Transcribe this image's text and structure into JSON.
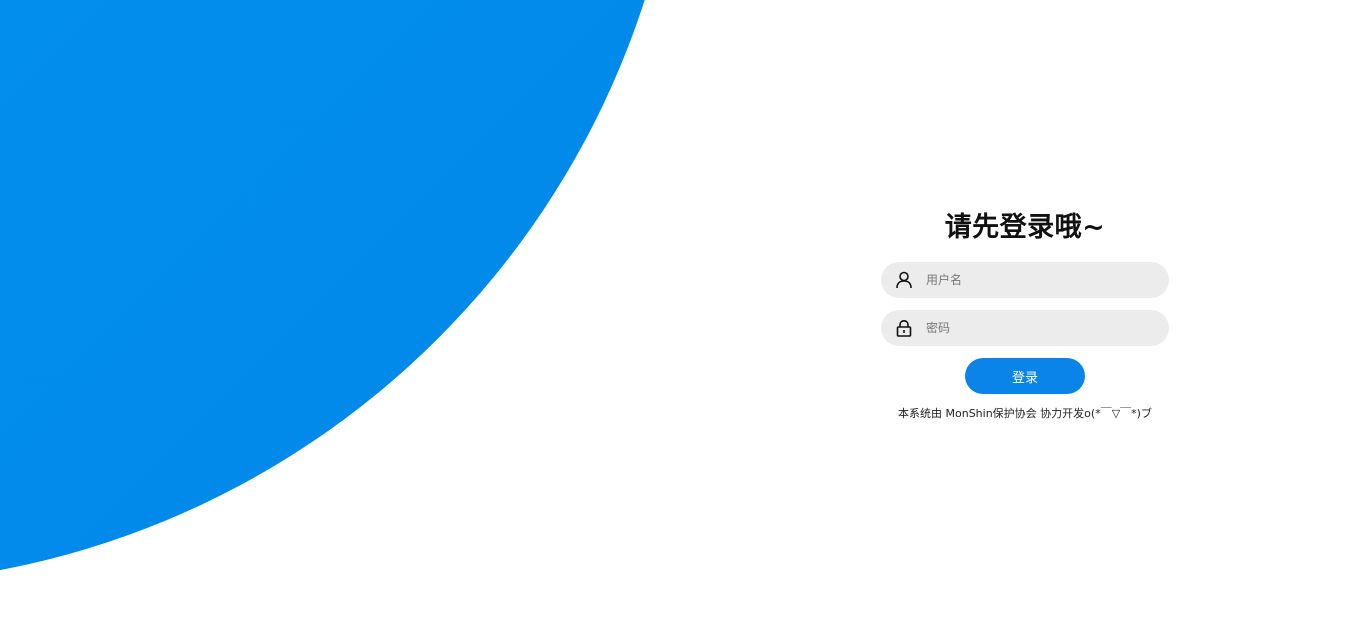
{
  "login": {
    "title": "请先登录哦~",
    "username": {
      "placeholder": "用户名",
      "value": "",
      "icon": "user-icon"
    },
    "password": {
      "placeholder": "密码",
      "value": "",
      "icon": "lock-icon"
    },
    "submit_label": "登录",
    "footer_text": "本系统由 MonShin保护协会 协力开发o(*￣▽￣*)ブ"
  },
  "colors": {
    "accent": "#0a84e8",
    "background_shape": "#0292ef",
    "field_bg": "#ececec"
  }
}
